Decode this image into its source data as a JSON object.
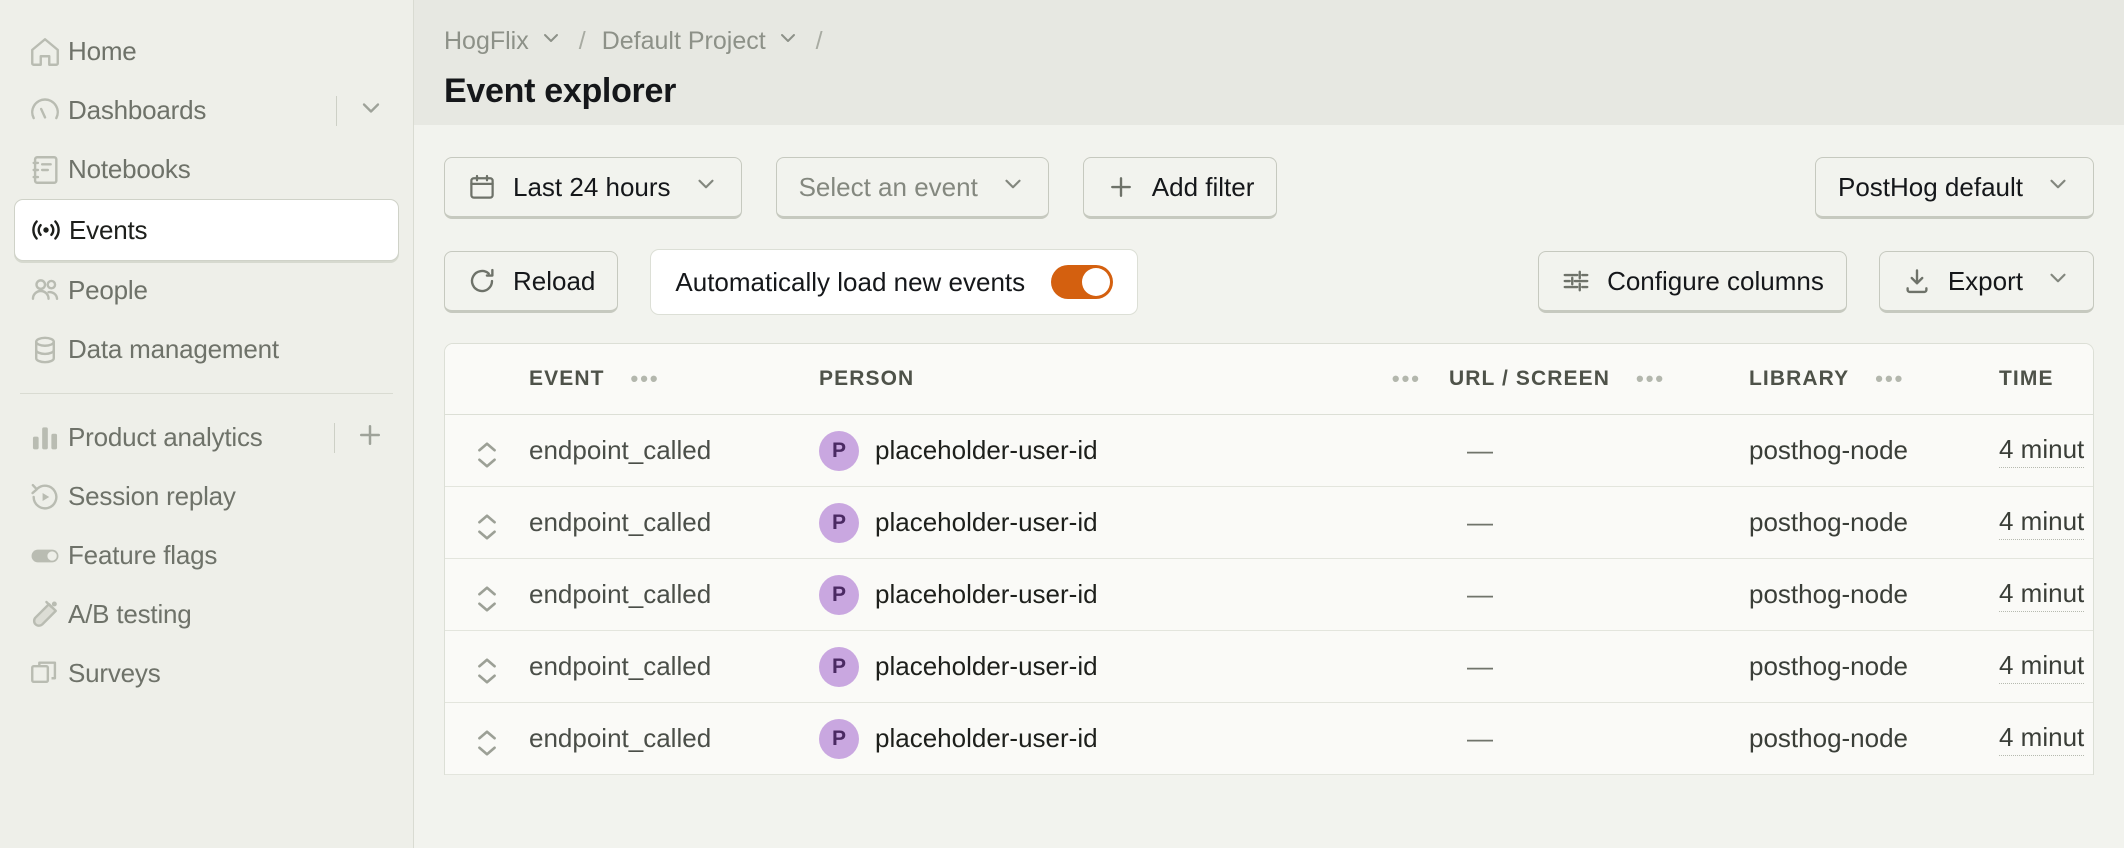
{
  "sidebar": {
    "items": [
      {
        "label": "Home",
        "icon": "home-icon",
        "active": false,
        "accessory": null
      },
      {
        "label": "Dashboards",
        "icon": "gauge-icon",
        "active": false,
        "accessory": "chevron-down-icon"
      },
      {
        "label": "Notebooks",
        "icon": "notebook-icon",
        "active": false,
        "accessory": null
      },
      {
        "label": "Events",
        "icon": "broadcast-icon",
        "active": true,
        "accessory": null
      },
      {
        "label": "People",
        "icon": "people-icon",
        "active": false,
        "accessory": null
      },
      {
        "label": "Data management",
        "icon": "database-icon",
        "active": false,
        "accessory": null
      }
    ],
    "items2": [
      {
        "label": "Product analytics",
        "icon": "bar-chart-icon",
        "active": false,
        "accessory": "plus-icon"
      },
      {
        "label": "Session replay",
        "icon": "replay-icon",
        "active": false,
        "accessory": null
      },
      {
        "label": "Feature flags",
        "icon": "toggle-icon",
        "active": false,
        "accessory": null
      },
      {
        "label": "A/B testing",
        "icon": "flask-icon",
        "active": false,
        "accessory": null
      },
      {
        "label": "Surveys",
        "icon": "windows-icon",
        "active": false,
        "accessory": null
      }
    ]
  },
  "breadcrumb": {
    "org": "HogFlix",
    "project": "Default Project",
    "slash": "/",
    "trailing_slash": "/"
  },
  "header": {
    "title": "Event explorer"
  },
  "toolbar": {
    "date_range": "Last 24 hours",
    "event_placeholder": "Select an event",
    "add_filter": "Add filter",
    "add_filter_glyph": "+",
    "data_source": "PostHog default",
    "reload": "Reload",
    "auto_load": "Automatically load new events",
    "auto_load_enabled": true,
    "configure_columns": "Configure columns",
    "export": "Export"
  },
  "table": {
    "columns": [
      {
        "key": "expand",
        "label": "",
        "dots": false
      },
      {
        "key": "event",
        "label": "EVENT",
        "dots": true
      },
      {
        "key": "person",
        "label": "PERSON",
        "dots": true
      },
      {
        "key": "url",
        "label": "URL / SCREEN",
        "dots": true
      },
      {
        "key": "library",
        "label": "LIBRARY",
        "dots": true
      },
      {
        "key": "time",
        "label": "TIME",
        "dots": false
      }
    ],
    "dots_glyph": "•••",
    "rows": [
      {
        "event": "endpoint_called",
        "avatar": "P",
        "person": "placeholder-user-id",
        "url": "—",
        "library": "posthog-node",
        "time": "4 minut"
      },
      {
        "event": "endpoint_called",
        "avatar": "P",
        "person": "placeholder-user-id",
        "url": "—",
        "library": "posthog-node",
        "time": "4 minut"
      },
      {
        "event": "endpoint_called",
        "avatar": "P",
        "person": "placeholder-user-id",
        "url": "—",
        "library": "posthog-node",
        "time": "4 minut"
      },
      {
        "event": "endpoint_called",
        "avatar": "P",
        "person": "placeholder-user-id",
        "url": "—",
        "library": "posthog-node",
        "time": "4 minut"
      },
      {
        "event": "endpoint_called",
        "avatar": "P",
        "person": "placeholder-user-id",
        "url": "—",
        "library": "posthog-node",
        "time": "4 minut"
      }
    ]
  },
  "colors": {
    "accent": "#d4600f",
    "avatar_bg": "#c9a7e0",
    "sidebar_bg": "#eeefe9",
    "main_bg": "#f2f3ee",
    "topbar_bg": "#e7e8e2"
  }
}
